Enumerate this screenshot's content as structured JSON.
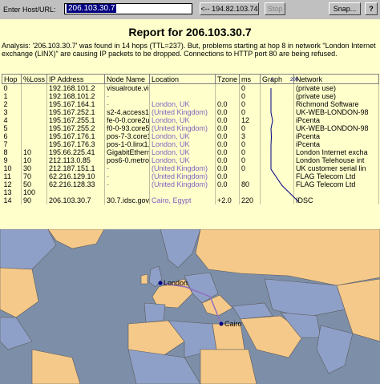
{
  "toolbar": {
    "host_label": "Enter Host/URL:",
    "host_value": "206.103.30.7",
    "back_label": "<-- 194.82.103.74",
    "stop_label": "Stop",
    "snap_label": "Snap...",
    "help_label": "?"
  },
  "report": {
    "title": "Report for 206.103.30.7",
    "analysis": "Analysis: '206.103.30.7' was found in 14 hops (TTL=237). But, problems starting at hop 8 in network \"London Internet exchange (LINX)\" are causing IP packets to be dropped. Connections to HTTP port 80 are being refused."
  },
  "table": {
    "headers": [
      "Hop",
      "%Loss",
      "IP Address",
      "Node Name",
      "Location",
      "Tzone",
      "ms",
      "Graph",
      "Network"
    ],
    "graph_scale": [
      "0",
      "200"
    ],
    "rows": [
      {
        "hop": "0",
        "loss": "",
        "ip": "192.168.101.2",
        "node": "visualroute.visi...",
        "loc": "",
        "tz": "",
        "ms": "0",
        "net": "(private use)"
      },
      {
        "hop": "1",
        "loss": "",
        "ip": "192.168.101.2",
        "node": "-",
        "loc": "",
        "tz": "",
        "ms": "0",
        "net": "(private use)"
      },
      {
        "hop": "2",
        "loss": "",
        "ip": "195.167.164.1",
        "node": "-",
        "loc": "London, UK",
        "tz": "0.0",
        "ms": "0",
        "net": "Richmond Software"
      },
      {
        "hop": "3",
        "loss": "",
        "ip": "195.167.252.1",
        "node": "s2-4.access1.l",
        "loc": "(United Kingdom)",
        "tz": "0.0",
        "ms": "0",
        "net": "UK-WEB-LONDON-98"
      },
      {
        "hop": "4",
        "loss": "",
        "ip": "195.167.255.1",
        "node": "fe-0-0.core2uk",
        "loc": "London, UK",
        "tz": "0.0",
        "ms": "12",
        "net": "iPcenta"
      },
      {
        "hop": "5",
        "loss": "",
        "ip": "195.167.255.2",
        "node": "f0-0-93.core56",
        "loc": "(United Kingdom)",
        "tz": "0.0",
        "ms": "0",
        "net": "UK-WEB-LONDON-98"
      },
      {
        "hop": "6",
        "loss": "",
        "ip": "195.167.176.1",
        "node": "pos-7-3.core1.",
        "loc": "London, UK",
        "tz": "0.0",
        "ms": "3",
        "net": "iPcenta"
      },
      {
        "hop": "7",
        "loss": "",
        "ip": "195.167.176.3",
        "node": "pos-1-0.linx1.h",
        "loc": "London, UK",
        "tz": "0.0",
        "ms": "0",
        "net": "iPcenta"
      },
      {
        "hop": "8",
        "loss": "10",
        "ip": "195.66.225.41",
        "node": "GigabitEtherne",
        "loc": "London, UK",
        "tz": "0.0",
        "ms": "0",
        "net": "London Internet excha"
      },
      {
        "hop": "9",
        "loss": "10",
        "ip": "212.113.0.85",
        "node": "pos6-0.metro1",
        "loc": "London, UK",
        "tz": "0.0",
        "ms": "0",
        "net": "London Telehouse int"
      },
      {
        "hop": "10",
        "loss": "30",
        "ip": "212.187.151.1",
        "node": "-",
        "loc": "(United Kingdom)",
        "tz": "0.0",
        "ms": "0",
        "net": "UK customer serial lin"
      },
      {
        "hop": "11",
        "loss": "70",
        "ip": "62.216.129.10",
        "node": "-",
        "loc": "(United Kingdom)",
        "tz": "0.0",
        "ms": "",
        "net": "FLAG Telecom Ltd"
      },
      {
        "hop": "12",
        "loss": "50",
        "ip": "62.216.128.33",
        "node": "-",
        "loc": "(United Kingdom)",
        "tz": "0.0",
        "ms": "80",
        "net": "FLAG Telecom Ltd"
      },
      {
        "hop": "13",
        "loss": "100",
        "ip": "",
        "node": "",
        "loc": "",
        "tz": "",
        "ms": "",
        "net": ""
      },
      {
        "hop": "14",
        "loss": "90",
        "ip": "206.103.30.7",
        "node": "30.7.idsc.gov.e",
        "loc": "Cairo, Egypt",
        "tz": "+2.0",
        "ms": "220",
        "net": "IDSC"
      }
    ]
  },
  "map": {
    "labels": {
      "london": "London",
      "cairo": "Cairo"
    },
    "colors": {
      "sea": "#7d8fa8",
      "land_a": "#f5c98a",
      "land_b": "#8fa0c8",
      "route": "#9070c0"
    }
  }
}
